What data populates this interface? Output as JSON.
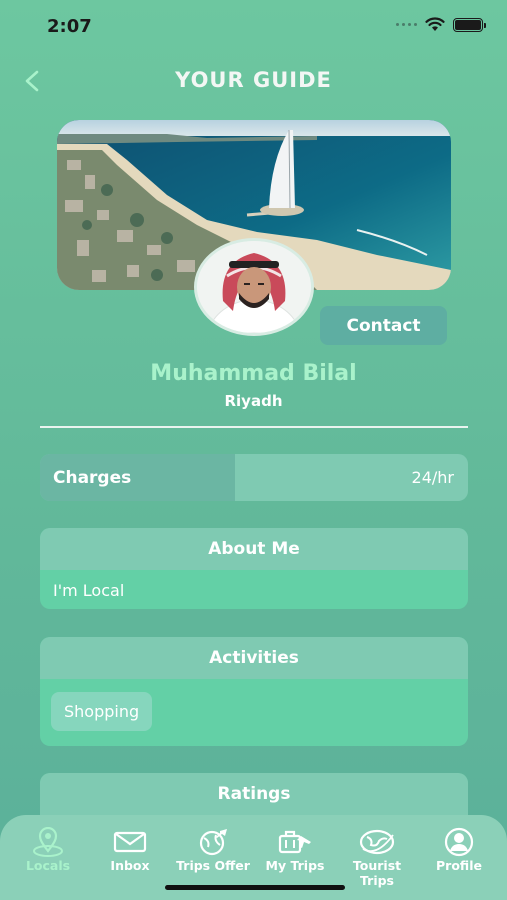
{
  "status_bar": {
    "time": "2:07"
  },
  "header": {
    "title": "YOUR GUIDE",
    "back_icon": "chevron-left-icon"
  },
  "hero": {
    "image": "burj-al-arab-coastline-photo"
  },
  "profile": {
    "contact_label": "Contact",
    "name": "Muhammad Bilal",
    "city": "Riyadh"
  },
  "charges": {
    "label": "Charges",
    "value": "24/hr"
  },
  "about": {
    "title": "About Me",
    "text": "I'm Local"
  },
  "activities": {
    "title": "Activities",
    "items": [
      "Shopping"
    ]
  },
  "ratings": {
    "title": "Ratings"
  },
  "tabs": [
    {
      "label": "Locals",
      "icon": "map-pin-icon",
      "active": true
    },
    {
      "label": "Inbox",
      "icon": "envelope-icon",
      "active": false
    },
    {
      "label": "Trips Offer",
      "icon": "globe-plane-icon",
      "active": false
    },
    {
      "label": "My Trips",
      "icon": "luggage-icon",
      "active": false
    },
    {
      "label": "Tourist Trips",
      "icon": "globe-icon",
      "active": false
    },
    {
      "label": "Profile",
      "icon": "user-icon",
      "active": false
    }
  ],
  "colors": {
    "accent": "#a9f2cb",
    "background": "#62b99a",
    "card": "#7fcab2"
  }
}
